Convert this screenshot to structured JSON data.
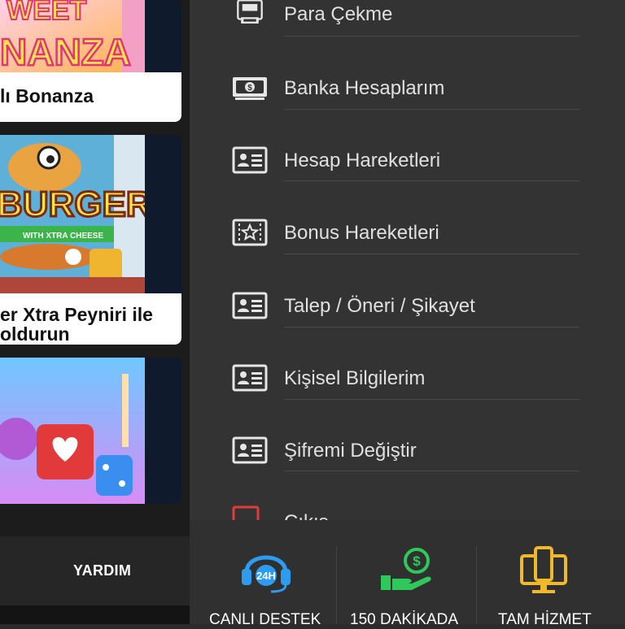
{
  "games": [
    {
      "logo": "WEET",
      "logo2": "NANZA",
      "title": "lı Bonanza"
    },
    {
      "logo": "BURGER",
      "logo_sub": "WITH XTRA CHEESE",
      "title_line1": "er Xtra Peyniri ile",
      "title_line2": "oldurun"
    },
    {
      "title": ""
    }
  ],
  "left_nav": {
    "help_label": "YARDIM"
  },
  "menu": {
    "items": [
      {
        "label": "Para Çekme",
        "icon": "atm-icon"
      },
      {
        "label": "Banka Hesaplarım",
        "icon": "banknote-icon"
      },
      {
        "label": "Hesap Hareketleri",
        "icon": "id-card-icon"
      },
      {
        "label": "Bonus Hareketleri",
        "icon": "bonus-ticket-icon"
      },
      {
        "label": "Talep / Öneri / Şikayet",
        "icon": "id-card-icon"
      },
      {
        "label": "Kişisel Bilgilerim",
        "icon": "id-card-icon"
      },
      {
        "label": "Şifremi Değiştir",
        "icon": "id-card-icon"
      },
      {
        "label": "Çıkış",
        "icon": "logout-icon"
      }
    ]
  },
  "support_bar": {
    "items": [
      {
        "label": "CANLI DESTEK",
        "icon": "headset-24h-icon",
        "color": "#2d9bf0",
        "badge": "24H"
      },
      {
        "label": "150 DAKİKADA",
        "icon": "money-hand-icon",
        "color": "#2fc85a",
        "badge": "$"
      },
      {
        "label": "TAM HİZMET",
        "icon": "devices-icon",
        "color": "#f0b92a"
      }
    ]
  },
  "colors": {
    "menu_bg": "#333333",
    "menu_text": "#e0e0e0",
    "accent_red": "#e23b3b"
  }
}
